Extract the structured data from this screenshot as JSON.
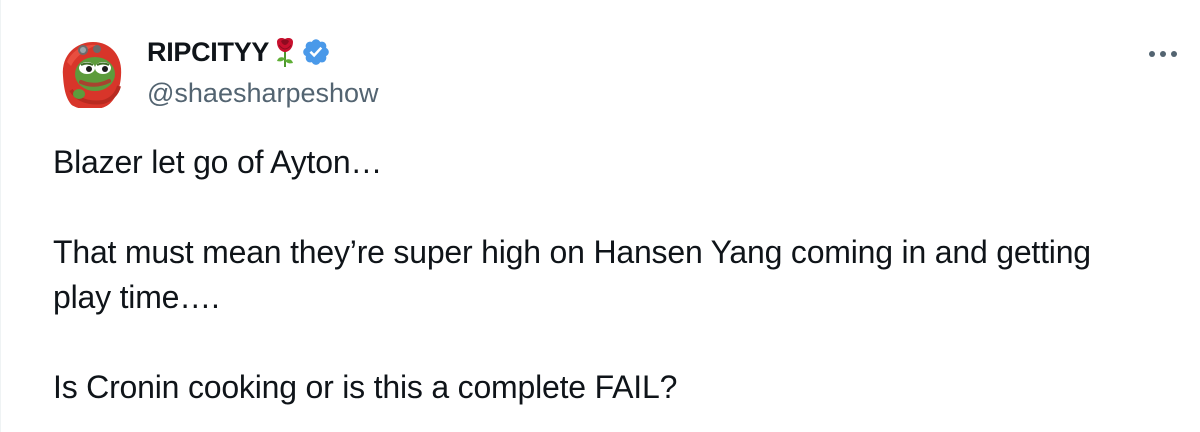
{
  "author": {
    "display_name": "RIPCITYY",
    "handle": "@shaesharpeshow",
    "name_emoji": "rose-icon",
    "verified": true,
    "verified_color": "#4a99e9"
  },
  "tweet": {
    "paragraphs": [
      "Blazer let go of Ayton…",
      "That must mean they’re super high on Hansen Yang coming in and getting play time….",
      "Is Cronin cooking or is this a complete FAIL?"
    ]
  },
  "icons": {
    "more": "more-horizontal-icon",
    "avatar": "avatar"
  }
}
